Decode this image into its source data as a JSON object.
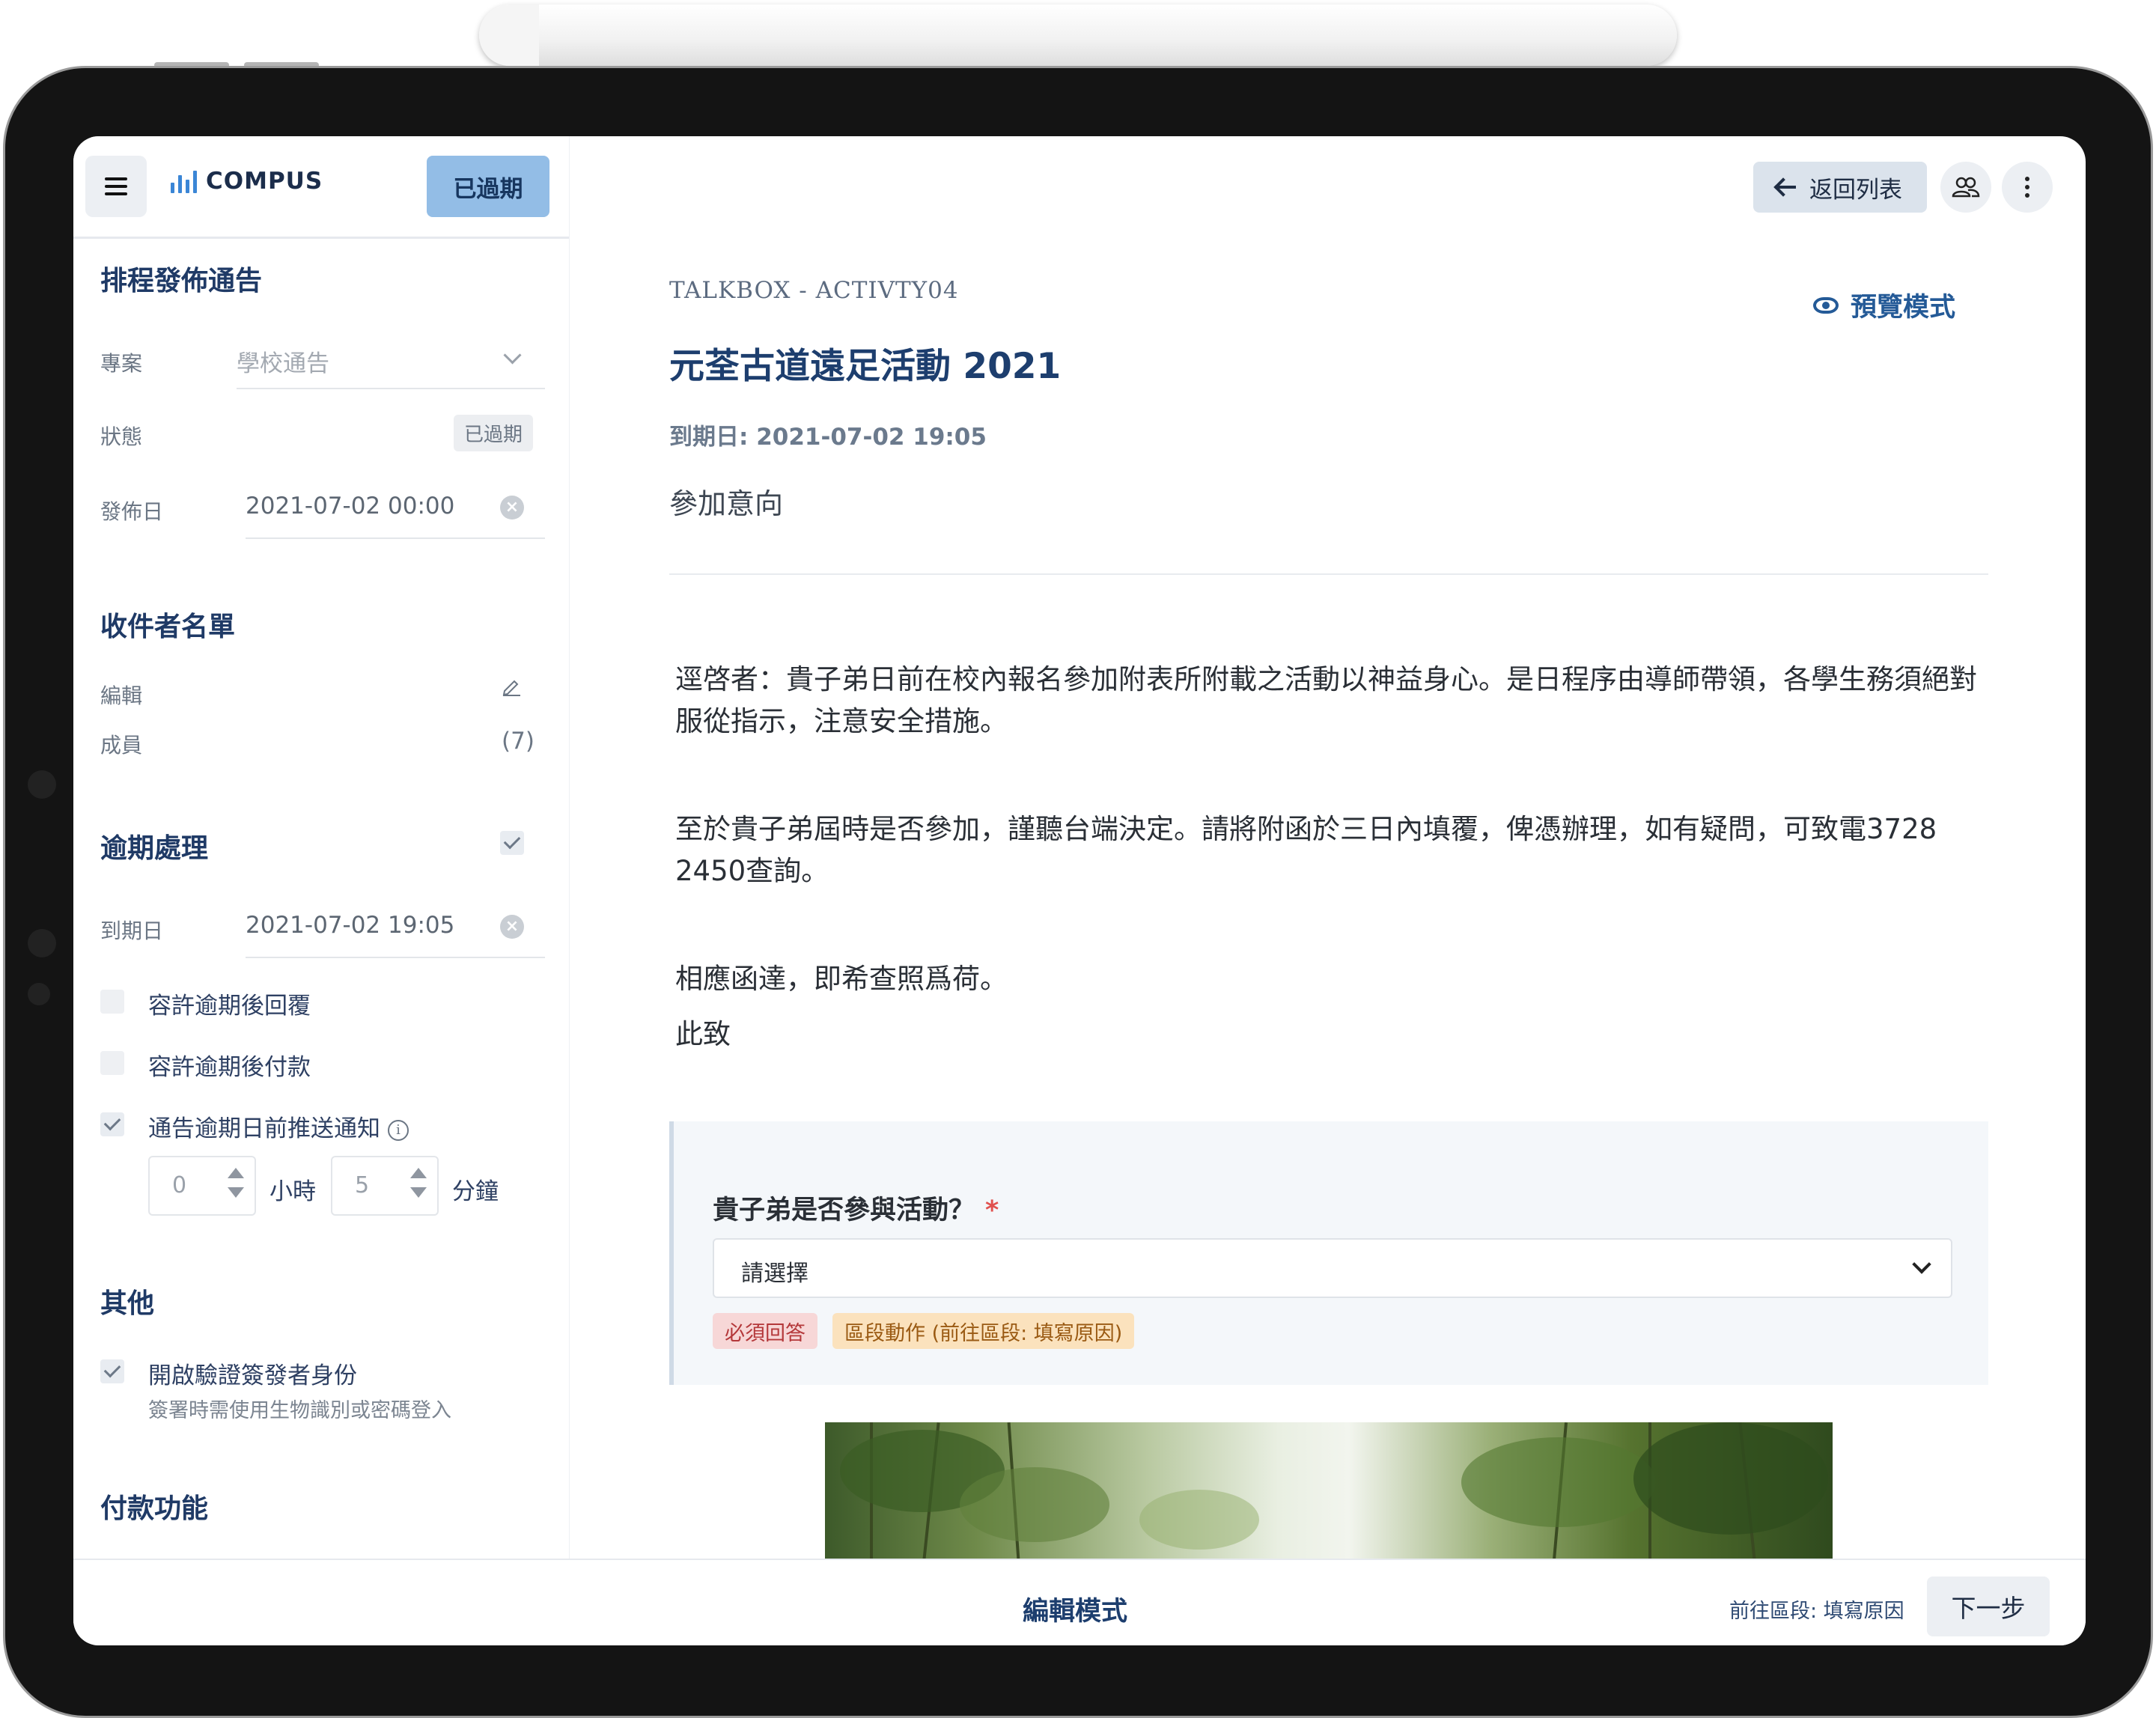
{
  "app": {
    "brand": "COMPUS",
    "status_pill": "已過期"
  },
  "sidebar": {
    "schedule_title": "排程發佈通告",
    "project_label": "專案",
    "project_placeholder": "學校通告",
    "status_label": "狀態",
    "status_value": "已過期",
    "publish_label": "發佈日",
    "publish_value": "2021-07-02 00:00",
    "recipients_title": "收件者名單",
    "edit_label": "編輯",
    "members_label": "成員",
    "members_count": "(7)",
    "overdue_title": "逾期處理",
    "due_label": "到期日",
    "due_value": "2021-07-02 19:05",
    "options": [
      {
        "label": "容許逾期後回覆",
        "checked": false
      },
      {
        "label": "容許逾期後付款",
        "checked": false
      },
      {
        "label": "通告逾期日前推送通知",
        "checked": true
      }
    ],
    "hours_value": "0",
    "hours_unit": "小時",
    "minutes_value": "5",
    "minutes_unit": "分鐘",
    "other_title": "其他",
    "verify_label": "開啟驗證簽發者身份",
    "verify_note": "簽署時需使用生物識別或密碼登入",
    "verify_checked": true,
    "payment_title": "付款功能"
  },
  "header": {
    "back_label": "返回列表"
  },
  "document": {
    "breadcrumb": "TALKBOX - ACTIVTY04",
    "preview_label": "預覽模式",
    "title": "元荃古道遠足活動 2021",
    "due": "到期日: 2021-07-02 19:05",
    "subtitle": "參加意向",
    "paragraphs": [
      "逕啓者：貴子弟日前在校內報名參加附表所附載之活動以神益身心。是日程序由導師帶領，各學生務須絕對服從指示，注意安全措施。",
      "至於貴子弟屆時是否參加，謹聽台端決定。請將附函於三日內填覆，俾憑辦理，如有疑問，可致電3728 2450查詢。",
      "相應函達，即希查照爲荷。",
      "此致"
    ],
    "question": {
      "label": "貴子弟是否參與活動？",
      "required_mark": "*",
      "select_placeholder": "請選擇",
      "badge_required": "必須回答",
      "badge_action": "區段動作 (前往區段: 填寫原因)"
    }
  },
  "footer": {
    "mode_label": "編輯模式",
    "next_hint": "前往區段: 填寫原因",
    "next_button": "下一步"
  },
  "colors": {
    "accent": "#1d3e6e",
    "status_pill_bg": "#93bde6",
    "badge_red_bg": "#f7d7d7",
    "badge_yellow_bg": "#fbe2bd"
  }
}
